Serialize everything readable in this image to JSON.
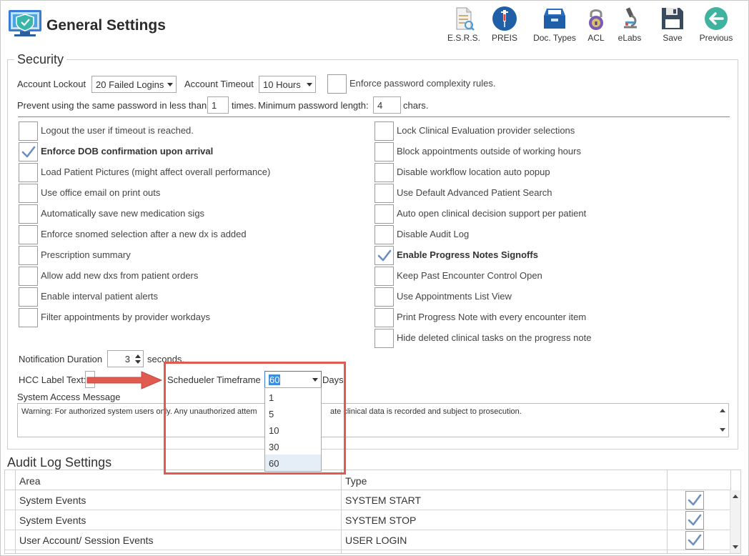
{
  "header": {
    "title": "General Settings"
  },
  "toolbar": [
    {
      "label": "E.S.R.S.",
      "icon": "document-search-icon"
    },
    {
      "label": "PREIS",
      "icon": "syringe-icon"
    },
    {
      "label": "Doc. Types",
      "icon": "file-drawer-icon"
    },
    {
      "label": "ACL",
      "icon": "lock-icon"
    },
    {
      "label": "eLabs",
      "icon": "microscope-icon"
    },
    {
      "label": "Save",
      "icon": "floppy-disk-icon"
    },
    {
      "label": "Previous",
      "icon": "back-arrow-icon"
    }
  ],
  "security": {
    "legend": "Security",
    "account_lockout_label": "Account Lockout",
    "account_lockout_value": "20 Failed Logins",
    "account_timeout_label": "Account Timeout",
    "account_timeout_value": "10 Hours",
    "enforce_complexity_label": "Enforce password complexity rules.",
    "reuse_prefix": "Prevent using the same password in less than",
    "reuse_value": "1",
    "reuse_suffix": "times.",
    "min_length_label": "Minimum password length:",
    "min_length_value": "4",
    "min_length_suffix": "chars.",
    "left_options": [
      {
        "label": "Logout the user if timeout is reached.",
        "checked": false
      },
      {
        "label": "Enforce DOB confirmation upon arrival",
        "checked": true
      },
      {
        "label": "Load Patient Pictures (might affect overall performance)",
        "checked": false
      },
      {
        "label": "Use office email on print outs",
        "checked": false
      },
      {
        "label": "Automatically save new medication sigs",
        "checked": false
      },
      {
        "label": "Enforce snomed selection after a new dx is added",
        "checked": false
      },
      {
        "label": "Prescription summary",
        "checked": false
      },
      {
        "label": "Allow add new dxs from patient orders",
        "checked": false
      },
      {
        "label": "Enable interval patient alerts",
        "checked": false
      },
      {
        "label": "Filter appointments by provider workdays",
        "checked": false
      }
    ],
    "right_options": [
      {
        "label": "Lock Clinical Evaluation provider selections",
        "checked": false
      },
      {
        "label": "Block appointments outside of working hours",
        "checked": false
      },
      {
        "label": "Disable workflow location auto popup",
        "checked": false
      },
      {
        "label": "Use Default Advanced Patient Search",
        "checked": false
      },
      {
        "label": "Auto open clinical decision support per patient",
        "checked": false
      },
      {
        "label": "Disable Audit Log",
        "checked": false
      },
      {
        "label": "Enable Progress Notes Signoffs",
        "checked": true
      },
      {
        "label": "Keep Past Encounter Control Open",
        "checked": false
      },
      {
        "label": "Use Appointments List View",
        "checked": false
      },
      {
        "label": "Print Progress Note with every encounter item",
        "checked": false
      },
      {
        "label": "Hide deleted clinical tasks on the progress note",
        "checked": false
      }
    ],
    "notification_label": "Notification Duration",
    "notification_value": "3",
    "notification_suffix": "seconds.",
    "hcc_label": "HCC Label Text:",
    "scheduler_label": "Schedueler Timeframe",
    "scheduler_value": "60",
    "scheduler_suffix": "Days",
    "scheduler_options": [
      "1",
      "5",
      "10",
      "30",
      "60"
    ],
    "system_access_label": "System Access Message",
    "system_access_left": "Warning: For authorized system users only. Any unauthorized attem",
    "system_access_right": "ate clinical data is recorded and subject to prosecution."
  },
  "audit": {
    "title": "Audit Log Settings",
    "columns": [
      "Area",
      "Type"
    ],
    "rows": [
      {
        "area": "System Events",
        "type": "SYSTEM START",
        "checked": true
      },
      {
        "area": "System Events",
        "type": "SYSTEM STOP",
        "checked": true
      },
      {
        "area": "User Account/ Session Events",
        "type": "USER LOGIN",
        "checked": true
      }
    ]
  },
  "colors": {
    "annotation": "#e05a50",
    "accent_blue": "#1f64b0",
    "check": "#6a8fc0"
  }
}
